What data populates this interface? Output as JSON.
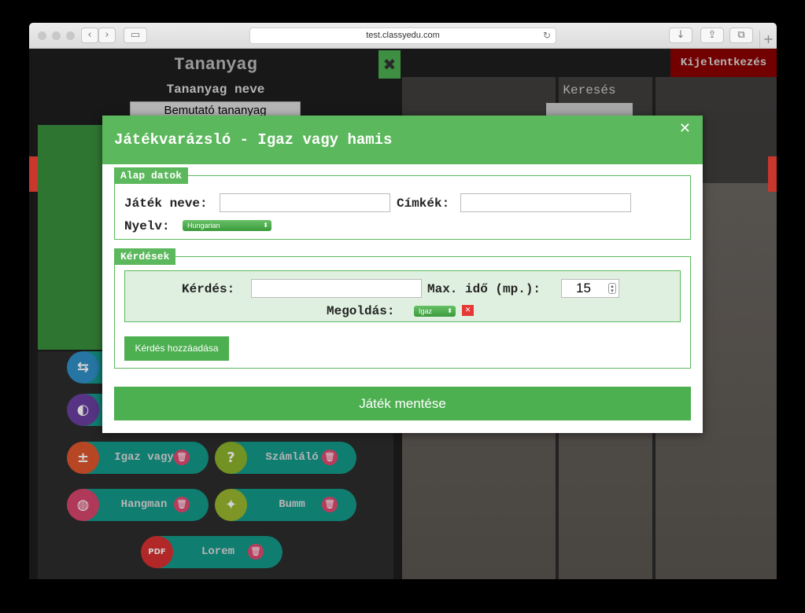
{
  "browser": {
    "url": "test.classyedu.com"
  },
  "left": {
    "title": "Tananyag",
    "subtitle": "Tananyag neve",
    "name_value": "Bemutató tananyag"
  },
  "right": {
    "logout_label": "Kijelentkezés",
    "search_label": "Keresés"
  },
  "games": [
    {
      "label": "",
      "icon": "exit-icon",
      "color": "#2f8fc7"
    },
    {
      "label": "",
      "icon": "fish-icon",
      "color": "#6a3fa0"
    },
    {
      "label": "Igaz vagy",
      "icon": "true-false-icon",
      "color": "#e0562c"
    },
    {
      "label": "Számláló",
      "icon": "question-icon",
      "color": "#8bb22b"
    },
    {
      "label": "Hangman",
      "icon": "balloon-icon",
      "color": "#d7466d"
    },
    {
      "label": "Bumm",
      "icon": "lightbulb-icon",
      "color": "#9ab82e"
    },
    {
      "label": "Lorem",
      "icon": "pdf-icon",
      "color": "#d93030"
    }
  ],
  "modal": {
    "title": "Játékvarázsló - Igaz vagy hamis",
    "basic": {
      "legend": "Alap datok",
      "game_name_label": "Játék neve:",
      "game_name_value": "",
      "tags_label": "Címkék:",
      "tags_value": "",
      "language_label": "Nyelv:",
      "language_value": "Hungarian"
    },
    "questions": {
      "legend": "Kérdések",
      "question_label": "Kérdés:",
      "question_value": "",
      "max_time_label": "Max. idő (mp.):",
      "max_time_value": "15",
      "solution_label": "Megoldás:",
      "solution_value": "Igaz",
      "add_button": "Kérdés hozzáadása"
    },
    "save_button": "Játék mentése"
  }
}
